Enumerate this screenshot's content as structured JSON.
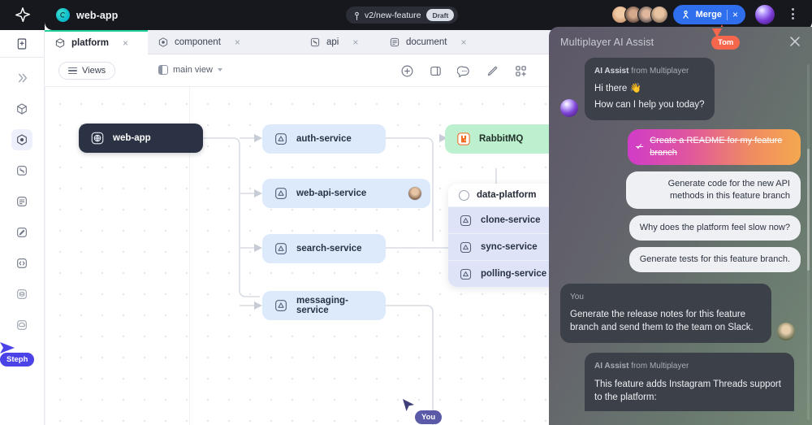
{
  "header": {
    "logo_icon": "star-logo-icon",
    "project_icon": "project-globe-icon",
    "project_name": "web-app",
    "branch_icon": "branch-icon",
    "branch_name": "v2/new-feature",
    "status_badge": "Draft",
    "merge_label": "Merge",
    "merge_close": "×",
    "merge_icon": "merge-branch-icon",
    "avatars": [
      "avatar-1",
      "avatar-2",
      "avatar-3",
      "avatar-4"
    ],
    "assistant_orb": "ai-orb-icon",
    "kebab": "more-options-icon",
    "accent_blue": "#2f6fed",
    "bar_bg": "#16181d"
  },
  "rail": {
    "top_icon": "document-page-icon",
    "items": [
      {
        "icon": "chevrons-right-icon",
        "name": "expand-rail"
      },
      {
        "icon": "cube-icon",
        "name": "platform"
      },
      {
        "icon": "hexagon-dot-icon",
        "name": "component"
      },
      {
        "icon": "arrows-collapse-icon",
        "name": "api"
      },
      {
        "icon": "lines-document-icon",
        "name": "document"
      },
      {
        "icon": "pen-square-icon",
        "name": "design"
      },
      {
        "icon": "code-brackets-icon",
        "name": "code"
      },
      {
        "icon": "coins-icon",
        "name": "cost"
      },
      {
        "icon": "cloud-icon",
        "name": "cloud"
      }
    ],
    "active_index": 2,
    "cursor": {
      "label": "Steph",
      "color": "#4b42e8"
    }
  },
  "tabs": [
    {
      "label": "platform",
      "icon": "cube-icon",
      "active": true,
      "close": "×"
    },
    {
      "label": "component",
      "icon": "hexagon-dot-icon",
      "active": false,
      "close": "×"
    },
    {
      "label": "api",
      "icon": "api-node-icon",
      "active": false,
      "close": "×"
    },
    {
      "label": "document",
      "icon": "lines-document-icon",
      "active": false,
      "close": "×"
    }
  ],
  "toolbar": {
    "views_label": "Views",
    "views_icon": "hamburger-icon",
    "view_name": "main view",
    "view_icon": "panel-icon",
    "view_chevron": "chevron-down-icon",
    "tools": [
      {
        "icon": "plus-circle-icon",
        "name": "add-node"
      },
      {
        "icon": "panel-toggle-icon",
        "name": "toggle-panel"
      },
      {
        "icon": "comment-icon",
        "name": "comments"
      },
      {
        "icon": "pencil-icon",
        "name": "draw"
      },
      {
        "icon": "grid-plus-icon",
        "name": "apps"
      }
    ]
  },
  "canvas": {
    "nodes": [
      {
        "id": "web-app",
        "label": "web-app",
        "icon": "globe-square-icon",
        "style": "dark"
      },
      {
        "id": "auth-service",
        "label": "auth-service",
        "icon": "service-triangle-icon",
        "style": "blue"
      },
      {
        "id": "web-api-service",
        "label": "web-api-service",
        "icon": "service-triangle-icon",
        "style": "blue",
        "avatar": "user-avatar"
      },
      {
        "id": "search-service",
        "label": "search-service",
        "icon": "service-triangle-icon",
        "style": "blue"
      },
      {
        "id": "messaging-service",
        "label": "messaging-service",
        "icon": "service-triangle-icon",
        "style": "blue"
      },
      {
        "id": "rabbitmq",
        "label": "RabbitMQ",
        "icon": "rabbitmq-icon",
        "style": "green"
      }
    ],
    "group": {
      "title": "data-platform",
      "title_icon": "circle-outline-icon",
      "rows": [
        {
          "label": "clone-service",
          "icon": "service-triangle-icon"
        },
        {
          "label": "sync-service",
          "icon": "service-triangle-icon"
        },
        {
          "label": "polling-service",
          "icon": "service-triangle-icon"
        }
      ]
    },
    "cursor": {
      "label": "You",
      "color": "#5b5aa8"
    }
  },
  "ai_panel": {
    "title": "Multiplayer AI Assist",
    "presence_badge": "Tom",
    "presence_color": "#f4674d",
    "close_icon": "close-icon",
    "messages": [
      {
        "role": "assistant",
        "author": "AI Assist",
        "author_suffix": "from Multiplayer",
        "lines": [
          "Hi there 👋",
          "How can I help you today?"
        ]
      },
      {
        "role": "user",
        "author": "You",
        "lines": [
          "Generate the release notes for this feature branch and send them to the team on Slack."
        ]
      },
      {
        "role": "assistant",
        "author": "AI Assist",
        "author_suffix": "from Multiplayer",
        "lines": [
          "This feature adds Instagram Threads support to the platform:"
        ]
      }
    ],
    "suggestions": [
      {
        "label": "Create a README for my feature branch",
        "done": true,
        "check": "✓"
      },
      {
        "label": "Generate code for the new API methods in this feature branch",
        "done": false
      },
      {
        "label": "Why does the platform feel slow now?",
        "done": false
      },
      {
        "label": "Generate tests for this feature branch.",
        "done": false
      }
    ]
  }
}
